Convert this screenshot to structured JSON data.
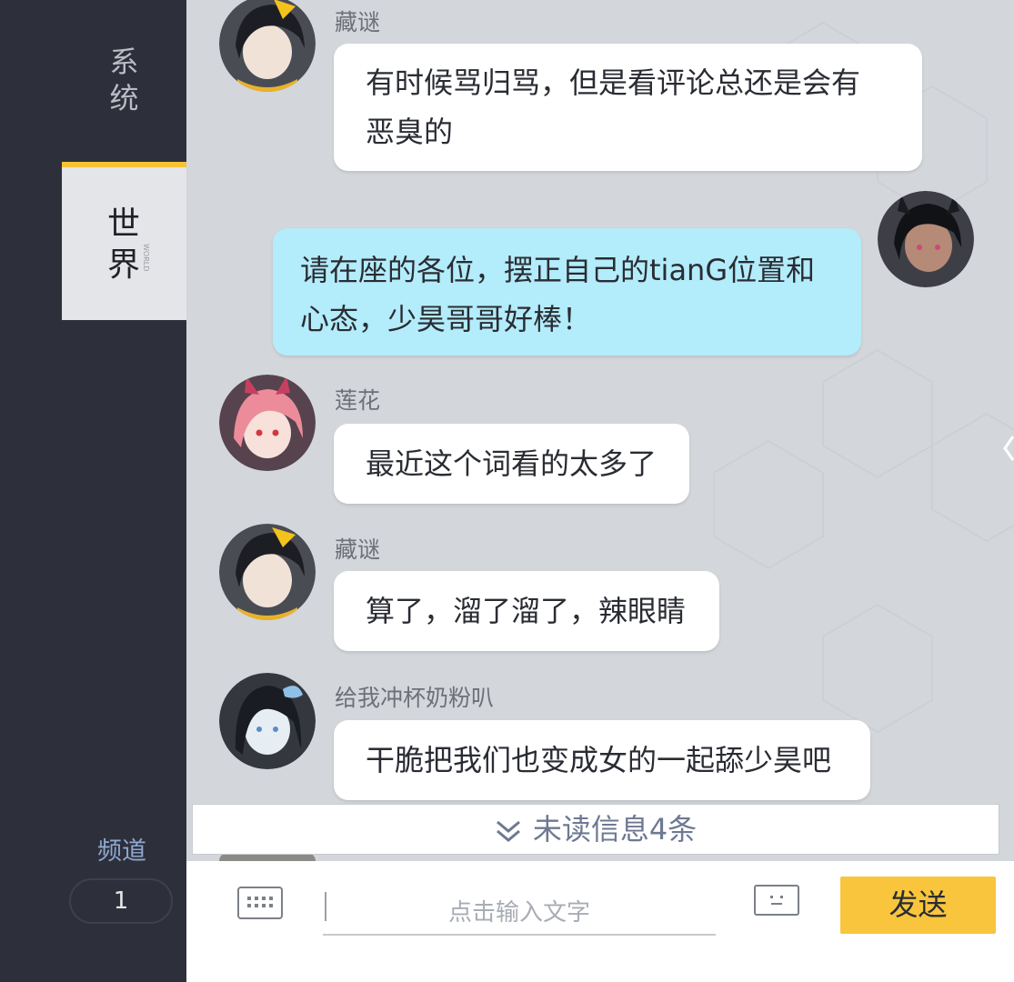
{
  "sidebar": {
    "tabs": [
      {
        "label": "系\n统",
        "active": false
      },
      {
        "label": "世\n界",
        "sub": "WORLD",
        "active": true
      }
    ],
    "channel_label": "频道",
    "channel_value": "1"
  },
  "messages": [
    {
      "name": "藏谜",
      "lines": [
        "有时候骂归骂，但是看评论总还是会有",
        "恶臭的"
      ],
      "mine": false,
      "avatar": "avatar-black-hair-yellow-bow"
    },
    {
      "name": "",
      "lines": [
        "请在座的各位，摆正自己的tianG位置和",
        "心态，少昊哥哥好棒！"
      ],
      "mine": true,
      "avatar": "avatar-dark-hair-bunny-ears"
    },
    {
      "name": "莲花",
      "lines": [
        "最近这个词看的太多了"
      ],
      "mine": false,
      "avatar": "avatar-pink-hair"
    },
    {
      "name": "藏谜",
      "lines": [
        "算了，溜了溜了，辣眼睛"
      ],
      "mine": false,
      "avatar": "avatar-black-hair-yellow-bow"
    },
    {
      "name": "给我冲杯奶粉叭",
      "lines": [
        "干脆把我们也变成女的一起舔少昊吧"
      ],
      "mine": false,
      "avatar": "avatar-dark-hair-blue-ribbon"
    }
  ],
  "unread_text": "未读信息4条",
  "input": {
    "placeholder": "点击输入文字",
    "send_label": "发送"
  },
  "colors": {
    "accent": "#f8c53c",
    "sidebar_bg": "#2d303b",
    "chat_bg": "#d3d6da",
    "my_bubble": "#b3ecfa"
  },
  "icons": [
    "keyboard-icon",
    "emoji-icon",
    "chevron-double-down-icon",
    "collapse-arrow-icon"
  ]
}
